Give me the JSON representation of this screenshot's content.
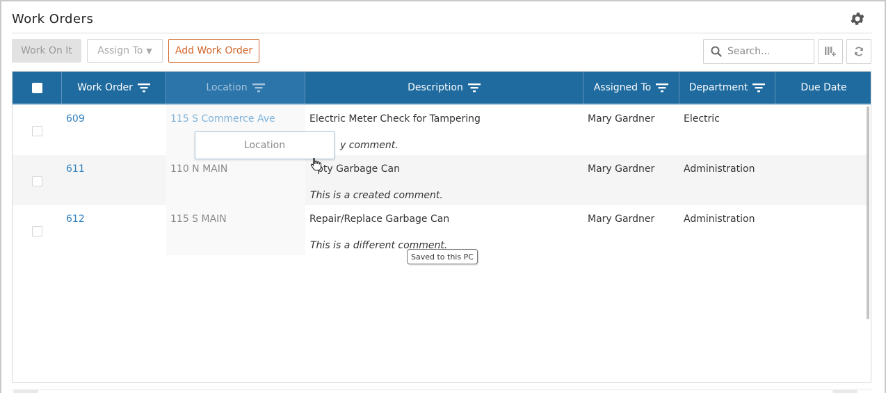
{
  "header": {
    "title": "Work Orders"
  },
  "toolbar": {
    "work_on_it": "Work On It",
    "assign_to": "Assign To",
    "assign_caret": "▼",
    "add_work_order": "Add Work Order",
    "search_placeholder": "Search..."
  },
  "columns": [
    "Work Order",
    "Location",
    "Description",
    "Assigned To",
    "Department",
    "Due Date"
  ],
  "rows": [
    {
      "id": "609",
      "location": "115 S Commerce Ave",
      "description": "Electric Meter Check for Tampering",
      "comment": "y comment.",
      "assigned_to": "Mary Gardner",
      "department": "Electric",
      "due_date": ""
    },
    {
      "id": "611",
      "location": "110 N MAIN",
      "description": "pty Garbage Can",
      "comment": "This is a created comment.",
      "assigned_to": "Mary Gardner",
      "department": "Administration",
      "due_date": ""
    },
    {
      "id": "612",
      "location": "115 S MAIN",
      "description": "Repair/Replace Garbage Can",
      "comment": "This is a different comment.",
      "assigned_to": "Mary Gardner",
      "department": "Administration",
      "due_date": ""
    }
  ],
  "drag_popup": "Location",
  "tooltip": "Saved to this PC",
  "colors": {
    "header_bg": "#1f6b9f",
    "link": "#2f7fbf",
    "accent": "#d2652a"
  },
  "icons": [
    "gear-icon",
    "search-icon",
    "columns-icon",
    "refresh-icon",
    "filter-icon",
    "hand-cursor-icon"
  ]
}
